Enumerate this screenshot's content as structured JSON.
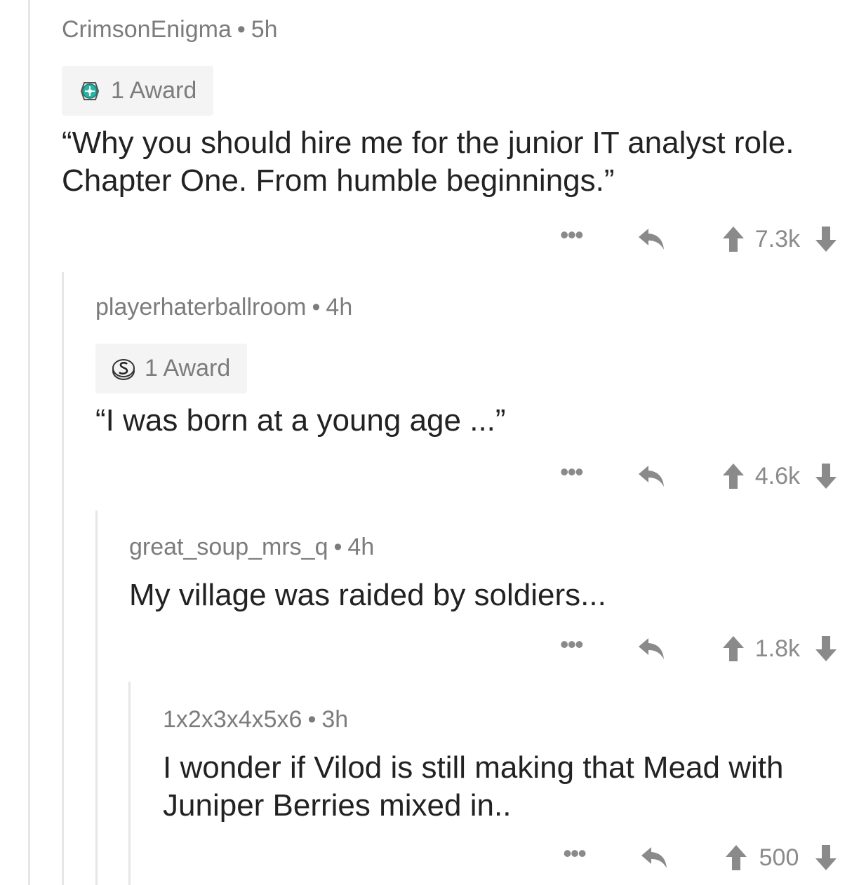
{
  "comments": [
    {
      "username": "CrimsonEnigma",
      "separator": "•",
      "age": "5h",
      "award": {
        "label": "1 Award",
        "icon": "award-medal-icon"
      },
      "body": "“Why you should hire me for the junior IT analyst role. Chapter One. From humble beginnings.”",
      "more": "•••",
      "score": "7.3k"
    },
    {
      "username": "playerhaterballroom",
      "separator": "•",
      "age": "4h",
      "award": {
        "label": "1 Award",
        "icon": "silver-award-icon"
      },
      "body": "“I was born at a young age ...”",
      "more": "•••",
      "score": "4.6k"
    },
    {
      "username": "great_soup_mrs_q",
      "separator": "•",
      "age": "4h",
      "body": "My village was raided by soldiers...",
      "more": "•••",
      "score": "1.8k"
    },
    {
      "username": "1x2x3x4x5x6",
      "separator": "•",
      "age": "3h",
      "body": "I wonder if Vilod is still making that Mead with Juniper Berries mixed in..",
      "more": "•••",
      "score": "500"
    }
  ],
  "colors": {
    "thread_line": "#e6e6e6",
    "meta_text": "#7c7c7c",
    "body_text": "#222222",
    "icon_gray": "#8a8a8a",
    "award_bg": "#f4f4f4"
  }
}
